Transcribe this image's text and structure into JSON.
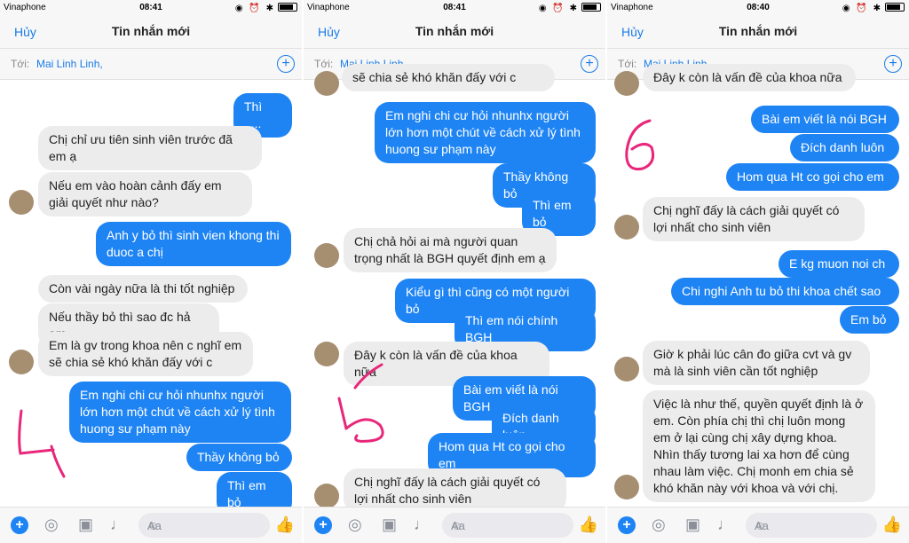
{
  "status": {
    "carrier": "Vinaphone"
  },
  "nav": {
    "cancel": "Hủy",
    "title": "Tin nhắn mới"
  },
  "to": {
    "label": "Tới:",
    "recipient": "Mai Linh Linh,"
  },
  "composer": {
    "placeholder": "Aa"
  },
  "annotations": {
    "color": "#e8267a",
    "numbers": [
      "4",
      "5",
      "6"
    ]
  },
  "panels": [
    {
      "time": "08:41",
      "messages": [
        {
          "dir": "out",
          "text": "Thì ....."
        },
        {
          "dir": "in",
          "text": "Chị chỉ ưu tiên sinh viên trước đã em ạ"
        },
        {
          "dir": "in",
          "text": "Nếu em vào hoàn cảnh đấy em giải quyết như nào?"
        },
        {
          "dir": "out",
          "text": "Anh y bỏ thì sinh vien khong thi duoc a chị"
        },
        {
          "dir": "in",
          "text": "Còn vài ngày nữa là thi tốt nghiệp"
        },
        {
          "dir": "in",
          "text": "Nếu thầy bỏ thì sao đc hả em"
        },
        {
          "dir": "in",
          "text": "Em là gv trong khoa nên c nghĩ em sẽ chia sẻ khó khăn đấy với c"
        },
        {
          "dir": "out",
          "text": "Em nghi chi cư hỏi nhunhx người lớn hơn một chút về cách xử lý tình huong sư phạm này"
        },
        {
          "dir": "out",
          "text": "Thầy không bỏ"
        },
        {
          "dir": "out",
          "text": "Thì em bỏ"
        }
      ]
    },
    {
      "time": "08:41",
      "messages": [
        {
          "dir": "in",
          "text": "sẽ chia sẻ khó khăn đấy với c"
        },
        {
          "dir": "out",
          "text": "Em nghi chi cư hỏi nhunhx người lớn hơn một chút về cách xử lý tình huong sư phạm này"
        },
        {
          "dir": "out",
          "text": "Thầy không bỏ"
        },
        {
          "dir": "out",
          "text": "Thì em bỏ"
        },
        {
          "dir": "in",
          "text": "Chị chả hỏi ai mà người quan trọng nhất là BGH quyết định em ạ"
        },
        {
          "dir": "out",
          "text": "Kiểu gì thì cũng có một người bỏ"
        },
        {
          "dir": "out",
          "text": "Thì em nói chính BGH"
        },
        {
          "dir": "in",
          "text": "Đây k còn là vấn đề của khoa nữa"
        },
        {
          "dir": "out",
          "text": "Bài em viết là nói BGH"
        },
        {
          "dir": "out",
          "text": "Đích danh luôn"
        },
        {
          "dir": "out",
          "text": "Hom qua Ht co gọi cho em"
        },
        {
          "dir": "in",
          "text": "Chị nghĩ đấy là cách giải quyết có lợi nhất cho sinh viên"
        }
      ]
    },
    {
      "time": "08:40",
      "messages": [
        {
          "dir": "in",
          "text": "Đây k còn là vấn đề của khoa nữa"
        },
        {
          "dir": "out",
          "text": "Bài em viết là nói BGH"
        },
        {
          "dir": "out",
          "text": "Đích danh luôn"
        },
        {
          "dir": "out",
          "text": "Hom qua Ht co gọi cho em"
        },
        {
          "dir": "in",
          "text": "Chị nghĩ đấy là cách giải quyết có lợi nhất cho sinh viên"
        },
        {
          "dir": "out",
          "text": "E kg muon noi ch"
        },
        {
          "dir": "out",
          "text": "Chi nghi Anh tu bỏ thi khoa chết sao"
        },
        {
          "dir": "out",
          "text": "Em bỏ"
        },
        {
          "dir": "in",
          "text": "Giờ k phải lúc cân đo giữa cvt và gv mà là sinh viên cần tốt nghiệp"
        },
        {
          "dir": "in",
          "text": "Việc là như thế, quyền quyết định là ở em. Còn phía chị thì chị luôn mong em ở lại cùng chị xây dựng khoa. Nhìn thấy tương lai xa hơn để cùng nhau làm việc. Chị monh em chia sẻ khó khăn này với khoa và với chị."
        }
      ]
    }
  ]
}
